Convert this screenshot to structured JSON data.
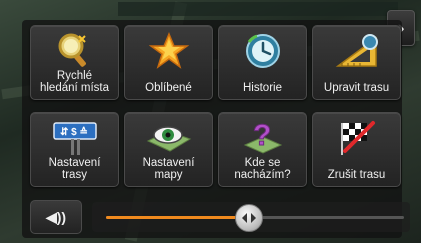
{
  "menu": {
    "tiles": [
      {
        "label_line1": "Rychlé",
        "label_line2": "hledání místa",
        "icon": "magnifier-icon"
      },
      {
        "label_line1": "",
        "label_line2": "Oblíbené",
        "icon": "star-icon"
      },
      {
        "label_line1": "",
        "label_line2": "Historie",
        "icon": "clock-history-icon"
      },
      {
        "label_line1": "",
        "label_line2": "Upravit trasu",
        "icon": "ruler-triangle-icon"
      },
      {
        "label_line1": "Nastavení",
        "label_line2": "trasy",
        "icon": "route-signs-icon"
      },
      {
        "label_line1": "Nastavení",
        "label_line2": "mapy",
        "icon": "map-eye-icon"
      },
      {
        "label_line1": "Kde se",
        "label_line2": "nacházím?",
        "icon": "question-map-icon"
      },
      {
        "label_line1": "",
        "label_line2": "Zrušit trasu",
        "icon": "checkered-flag-cross-icon"
      }
    ]
  },
  "nav": {
    "next_glyph": "›"
  },
  "volume": {
    "level_percent": 48,
    "speaker_glyph": "◀))"
  },
  "colors": {
    "accent": "#f08a1e",
    "tile_text": "#f0f0f0"
  }
}
